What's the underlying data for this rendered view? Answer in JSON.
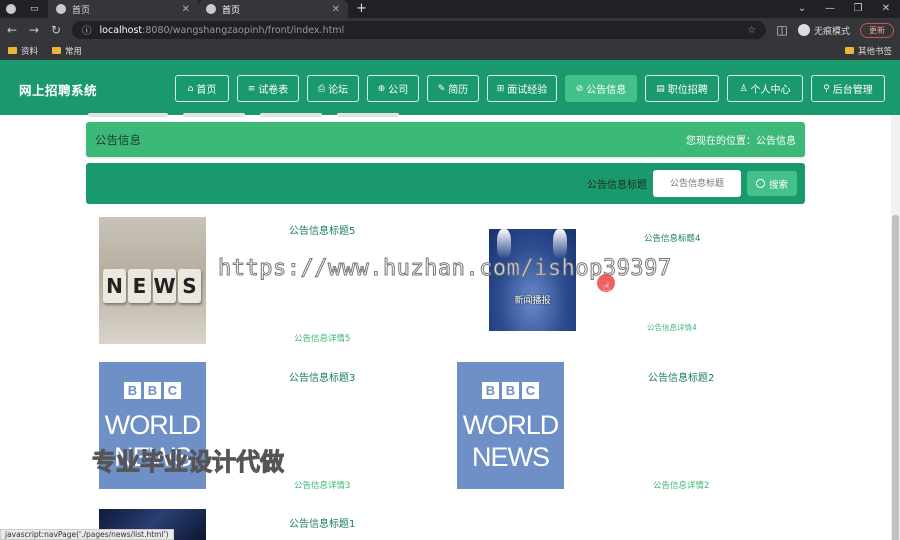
{
  "browser": {
    "tabs": [
      {
        "label": "首页"
      },
      {
        "label": "首页"
      }
    ],
    "url_host": "localhost",
    "url_path": ":8080/wangshangzaopinh/front/index.html",
    "incognito_label": "无痕模式",
    "update_label": "更新",
    "bookmarks": [
      "资料",
      "常用"
    ],
    "other_bookmarks": "其他书签"
  },
  "header": {
    "title": "网上招聘系统",
    "nav": [
      {
        "icon": "⌂",
        "label": "首页"
      },
      {
        "icon": "≡",
        "label": "试卷表"
      },
      {
        "icon": "⎙",
        "label": "论坛"
      },
      {
        "icon": "⊕",
        "label": "公司"
      },
      {
        "icon": "✎",
        "label": "简历"
      },
      {
        "icon": "⊞",
        "label": "面试经验"
      },
      {
        "icon": "⊘",
        "label": "公告信息"
      },
      {
        "icon": "▤",
        "label": "职位招聘"
      },
      {
        "icon": "♙",
        "label": "个人中心"
      },
      {
        "icon": "⚲",
        "label": "后台管理"
      }
    ],
    "active_index": 6
  },
  "info_bar": {
    "title": "公告信息",
    "location": "您现在的位置：公告信息"
  },
  "search": {
    "label": "公告信息标题",
    "placeholder": "公告信息标题",
    "button": "搜索"
  },
  "cards": [
    {
      "title": "公告信息标题5",
      "detail": "公告信息详情5",
      "image": "news-blocks"
    },
    {
      "title": "公告信息标题4",
      "detail": "公告信息详情4",
      "image": "spotlight",
      "image_text": "新闻播报"
    },
    {
      "title": "公告信息标题3",
      "detail": "公告信息详情3",
      "image": "bbc-world"
    },
    {
      "title": "公告信息标题2",
      "detail": "公告信息详情2",
      "image": "bbc-world"
    },
    {
      "title": "公告信息标题1",
      "detail": "",
      "image": "dark"
    }
  ],
  "news_letters": [
    "N",
    "E",
    "W",
    "S"
  ],
  "bbc": {
    "letters": [
      "B",
      "B",
      "C"
    ],
    "line1": "WORLD",
    "line2": "NEWS"
  },
  "watermark": "https://www.huzhan.com/ishop39397",
  "overlay_text": "专业毕业设计代做",
  "status_text": "javascript:navPage('./pages/news/list.html')"
}
